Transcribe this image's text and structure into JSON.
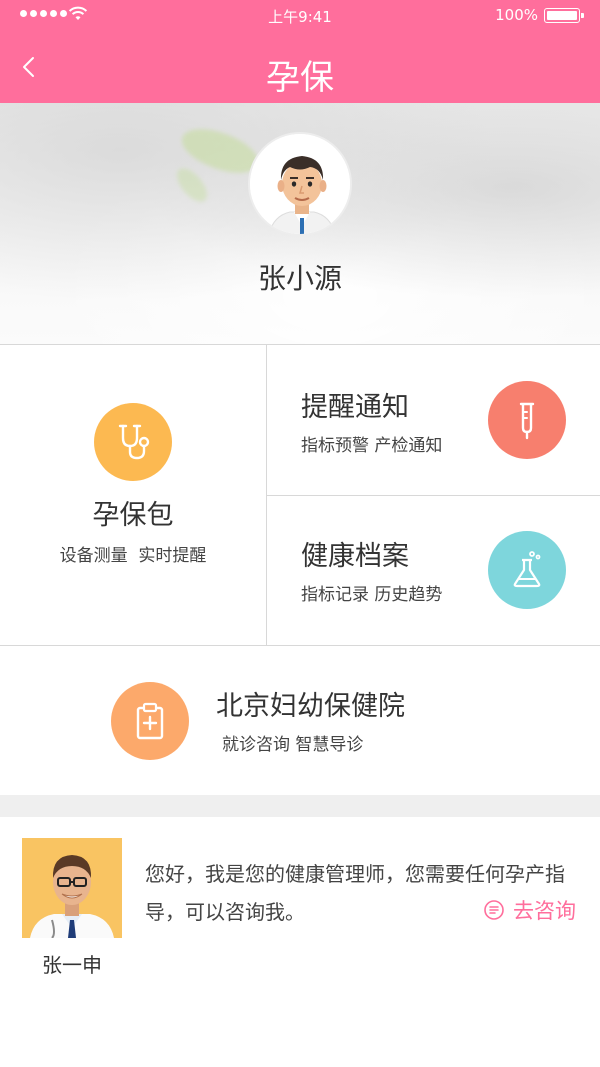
{
  "status_bar": {
    "time": "上午9:41",
    "battery": "100%"
  },
  "nav": {
    "title": "孕保"
  },
  "profile": {
    "name": "张小源"
  },
  "tiles": {
    "package": {
      "title": "孕保包",
      "subtitle": "设备测量  实时提醒"
    },
    "reminder": {
      "title": "提醒通知",
      "subtitle": "指标预警 产检通知"
    },
    "records": {
      "title": "健康档案",
      "subtitle": "指标记录 历史趋势"
    },
    "hospital": {
      "title": "北京妇幼保健院",
      "subtitle": "就诊咨询 智慧导诊"
    }
  },
  "consultant": {
    "name": "张一申",
    "message": "您好，我是您的健康管理师，您需要任何孕产指导，可以咨询我。",
    "button": "去咨询"
  },
  "colors": {
    "brand_pink": "#ff6e9c",
    "package_icon_bg": "#fcb951",
    "reminder_icon_bg": "#f77f6e",
    "records_icon_bg": "#7ed6dc",
    "hospital_icon_bg": "#fca96b"
  },
  "icons": {
    "back": "chevron-left-icon",
    "package": "stethoscope-icon",
    "reminder": "thermometer-icon",
    "records": "flask-icon",
    "hospital": "clipboard-plus-icon",
    "consult": "chat-bubble-icon"
  }
}
